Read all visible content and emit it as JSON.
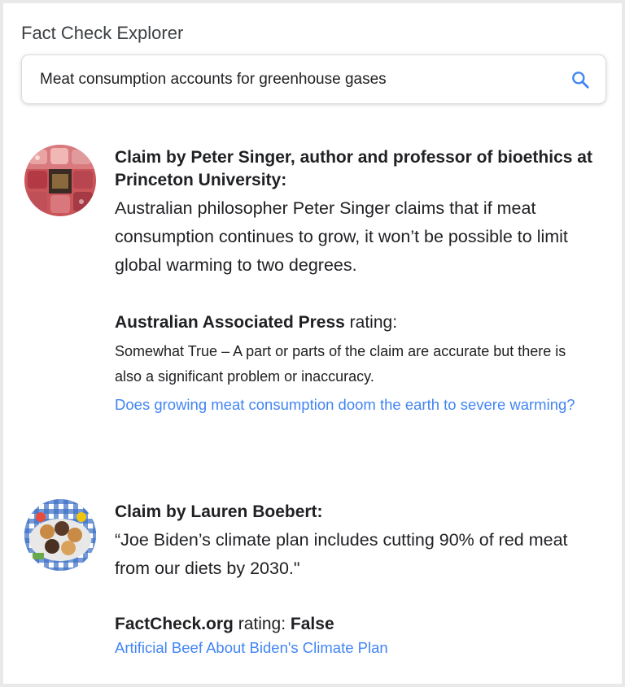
{
  "app": {
    "title": "Fact Check Explorer"
  },
  "search": {
    "value": "Meat consumption accounts for greenhouse gases"
  },
  "icons": {
    "search": "search-icon",
    "thumb1": "meat-display-thumbnail",
    "thumb2": "burgers-grill-thumbnail"
  },
  "colors": {
    "link": "#4285f4",
    "search_icon": "#4285f4",
    "text": "#202124"
  },
  "claims": [
    {
      "claimant": "Claim by Peter Singer, author and professor of bioethics at Princeton University:",
      "text": "Australian philosopher Peter Singer claims that if meat consumption continues to grow, it won’t be possible to limit global warming to two degrees.",
      "publisher": "Australian Associated Press",
      "rating_label": " rating:",
      "verdict": "",
      "rating_description": "Somewhat True – A part or parts of the claim are accurate but there is also a significant problem or inaccuracy.",
      "article": "Does growing meat consumption doom the earth to severe warming?"
    },
    {
      "claimant": "Claim by Lauren Boebert:",
      "text": "“Joe Biden’s climate plan includes cutting 90% of red meat from our diets by 2030.\"",
      "publisher": "FactCheck.org",
      "rating_label": " rating: ",
      "verdict": "False",
      "rating_description": "",
      "article": "Artificial Beef About Biden's Climate Plan"
    }
  ]
}
